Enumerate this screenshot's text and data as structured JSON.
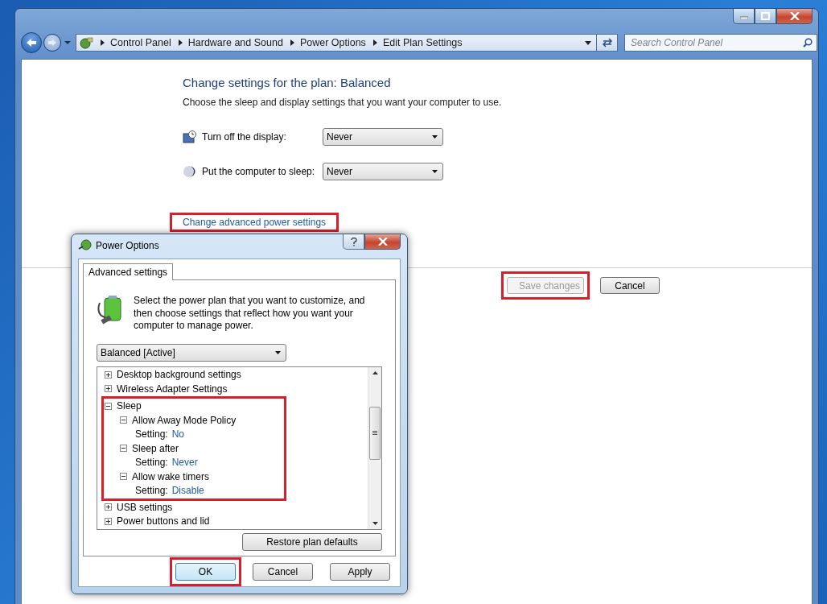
{
  "address_bar": {
    "crumbs": [
      "Control Panel",
      "Hardware and Sound",
      "Power Options",
      "Edit Plan Settings"
    ]
  },
  "search": {
    "placeholder": "Search Control Panel"
  },
  "plan": {
    "title": "Change settings for the plan: Balanced",
    "description": "Choose the sleep and display settings that you want your computer to use.",
    "settings": [
      {
        "kind": "display",
        "label": "Turn off the display:",
        "value": "Never"
      },
      {
        "kind": "sleep",
        "label": "Put the computer to sleep:",
        "value": "Never"
      }
    ]
  },
  "advanced_link": {
    "text": "Change advanced power settings",
    "highlighted": true
  },
  "buttons": [
    {
      "label": "Save changes",
      "disabled": true,
      "highlighted": true
    },
    {
      "label": "Cancel",
      "disabled": false,
      "highlighted": false
    }
  ],
  "dialog": {
    "title": "Power Options",
    "tabs": [
      {
        "label": "Advanced settings",
        "selected": true
      }
    ],
    "intro": "Select the power plan that you want to customize, and then choose settings that reflect how you want your computer to manage power.",
    "plan_select": {
      "value": "Balanced [Active]"
    },
    "tree": [
      {
        "kind": "group",
        "label": "Desktop background settings",
        "expanded": false,
        "highlighted": false
      },
      {
        "kind": "group",
        "label": "Wireless Adapter Settings",
        "expanded": false,
        "highlighted": false
      },
      {
        "kind": "group",
        "label": "Sleep",
        "expanded": true,
        "highlighted": true,
        "children": [
          {
            "kind": "group",
            "label": "Allow Away Mode Policy",
            "expanded": true,
            "children": [
              {
                "kind": "setting",
                "label": "Setting:",
                "value": "No"
              }
            ]
          },
          {
            "kind": "group",
            "label": "Sleep after",
            "expanded": true,
            "children": [
              {
                "kind": "setting",
                "label": "Setting:",
                "value": "Never"
              }
            ]
          },
          {
            "kind": "group",
            "label": "Allow wake timers",
            "expanded": true,
            "children": [
              {
                "kind": "setting",
                "label": "Setting:",
                "value": "Disable"
              }
            ]
          }
        ]
      },
      {
        "kind": "group",
        "label": "USB settings",
        "expanded": false,
        "highlighted": false
      },
      {
        "kind": "group",
        "label": "Power buttons and lid",
        "expanded": false,
        "highlighted": false
      }
    ],
    "restore_button": "Restore plan defaults",
    "buttons": [
      {
        "label": "OK",
        "default": true,
        "highlighted": true
      },
      {
        "label": "Cancel",
        "default": false,
        "highlighted": false
      },
      {
        "label": "Apply",
        "default": false,
        "highlighted": false
      }
    ]
  }
}
